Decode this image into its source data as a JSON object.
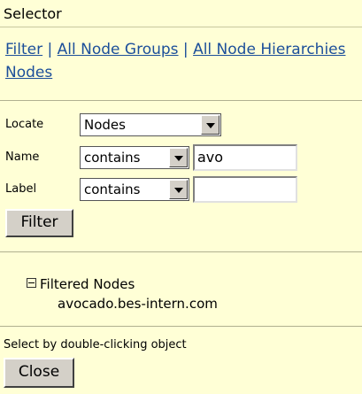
{
  "window": {
    "title": "Selector"
  },
  "nav": {
    "filter": "Filter",
    "sep": " | ",
    "all_node_groups": "All Node Groups",
    "all_node_hierarchies": "All Node Hierarchies",
    "nodes": "Nodes"
  },
  "form": {
    "locate_label": "Locate",
    "locate_value": "Nodes",
    "name_label": "Name",
    "name_op": "contains",
    "name_value": "avo",
    "label_label": "Label",
    "label_op": "contains",
    "label_value": "",
    "filter_button": "Filter"
  },
  "results": {
    "group": "Filtered Nodes",
    "item": "avocado.bes-intern.com"
  },
  "footer": {
    "hint": "Select by double-clicking object",
    "close_button": "Close"
  },
  "icons": {
    "collapse": "minus-box-icon",
    "dropdown": "chevron-down-icon"
  }
}
